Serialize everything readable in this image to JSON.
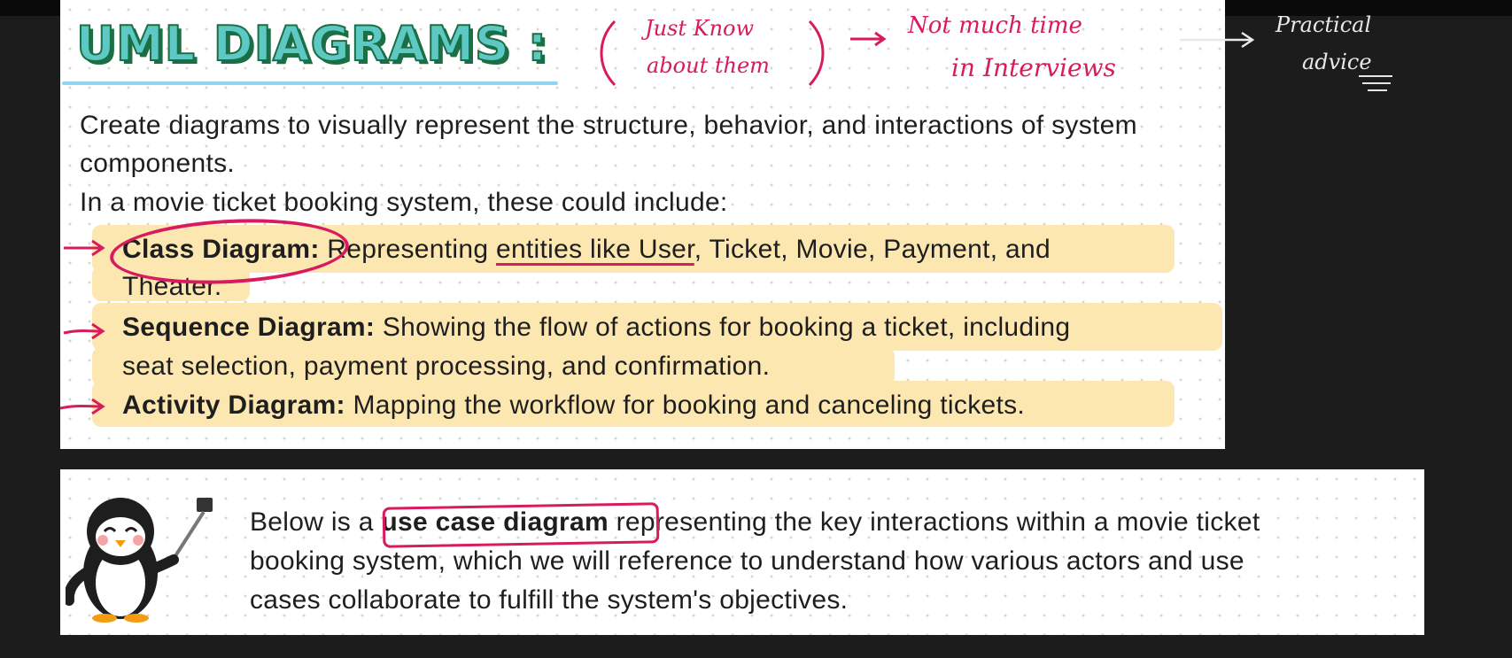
{
  "title": "UML DIAGRAMS :",
  "annotations": {
    "just_know_line1": "Just Know",
    "just_know_line2": "about them",
    "not_much_time_line1": "Not much time",
    "not_much_time_line2": "in Interviews",
    "practical_line1": "Practical",
    "practical_line2": "advice"
  },
  "intro": "Create diagrams to visually represent the structure, behavior, and interactions of system components.",
  "lead": "In a movie ticket booking system, these could include:",
  "items": [
    {
      "term": "Class Diagram:",
      "desc_a": " Representing ",
      "desc_u": "entities like User",
      "desc_b": ", Ticket, Movie, Payment, and",
      "desc_c": "Theater."
    },
    {
      "term": "Sequence Diagram:",
      "desc_a": " Showing the flow of actions for booking a ticket, including",
      "desc_c": "seat selection, payment processing, and confirmation."
    },
    {
      "term": "Activity Diagram:",
      "desc_a": " Mapping the workflow for booking and canceling tickets."
    }
  ],
  "note": {
    "part1": "Below is a ",
    "highlight": "use case diagram",
    "part2": " representing the key interactions within a movie ticket",
    "line2": "booking system, which we will reference to understand how various actors and use",
    "line3": "cases collaborate to fulfill the system's objectives."
  },
  "colors": {
    "accent": "#d81b60",
    "highlight": "#fde7b0",
    "title_fill": "#5ec9c4",
    "title_outline": "#1b6f45"
  }
}
